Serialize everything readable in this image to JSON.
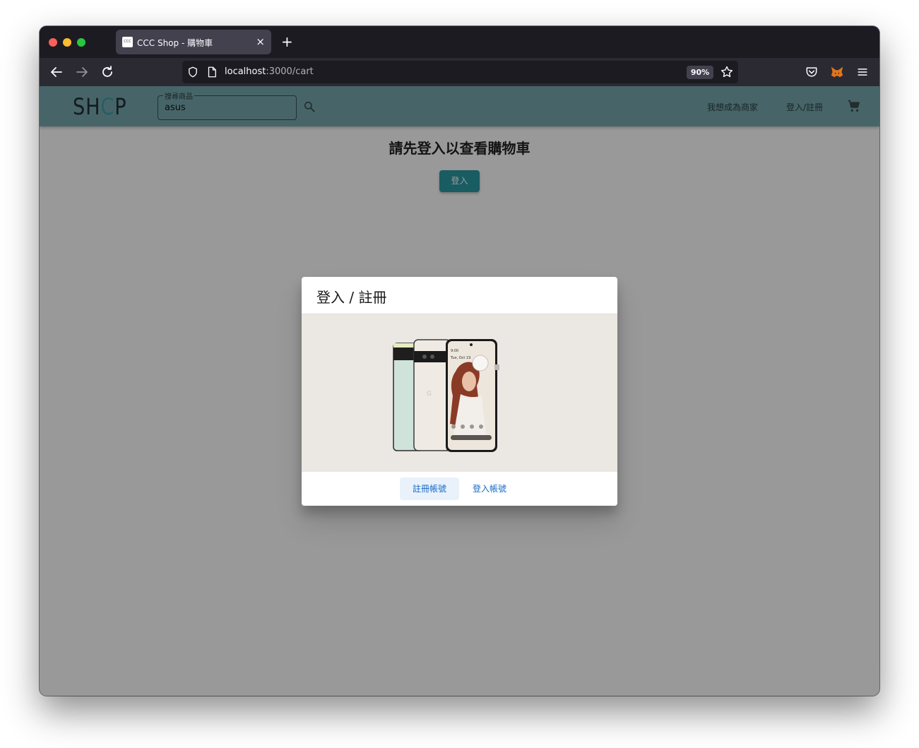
{
  "browser": {
    "tab_title": "CCC Shop - 購物車",
    "tab_favicon_text": "CCC",
    "new_tab_glyph": "+",
    "close_glyph": "×",
    "url_host": "localhost",
    "url_path": ":3000/cart",
    "zoom": "90%",
    "colors": {
      "red": "#ff5f57",
      "yellow": "#febc2e",
      "green": "#28c840"
    }
  },
  "appbar": {
    "logo_prefix": "SH",
    "logo_o": "C",
    "logo_suffix": "P",
    "search_label": "搜尋商品",
    "search_value": "asus",
    "become_seller": "我想成為商家",
    "login_register": "登入/註冊",
    "accent": "#77a9ae"
  },
  "page": {
    "heading": "請先登入以查看購物車",
    "login_button": "登入"
  },
  "dialog": {
    "title": "登入 / 註冊",
    "register_button": "註冊帳號",
    "login_button": "登入帳號",
    "phone_status_time": "9:00",
    "phone_date": "Tue, Oct 19"
  }
}
